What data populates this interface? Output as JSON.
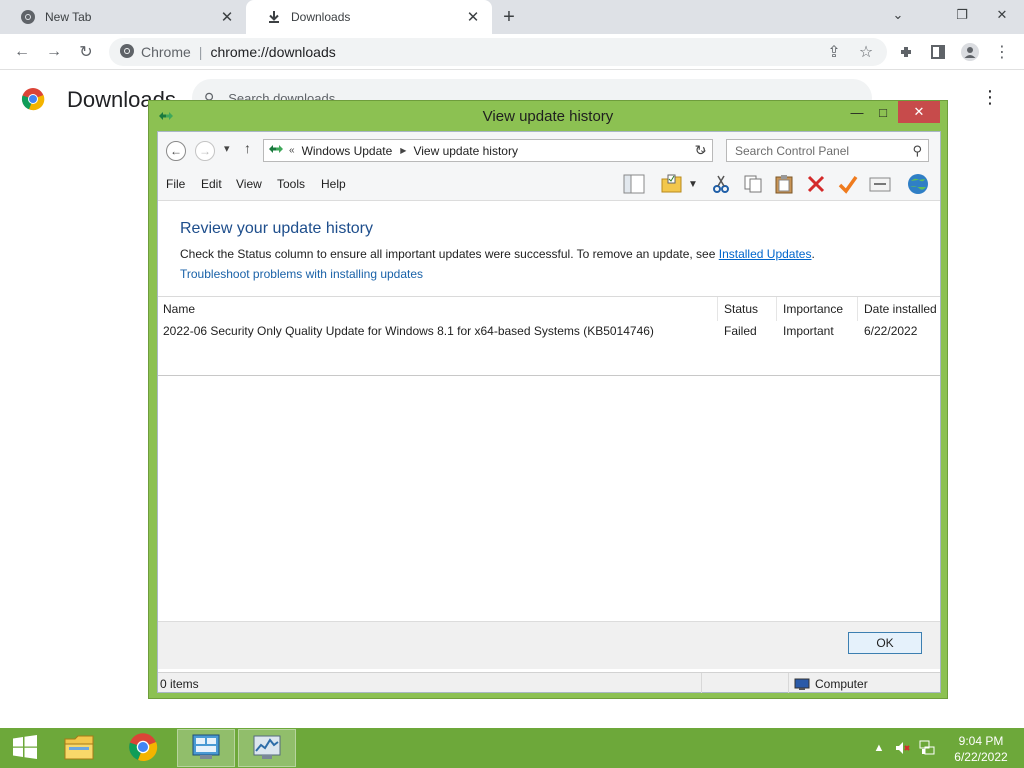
{
  "browser": {
    "tabs": [
      {
        "label": "New Tab",
        "icon": "chrome-icon"
      },
      {
        "label": "Downloads",
        "icon": "download-icon"
      }
    ],
    "omnibox": {
      "site": "Chrome",
      "url": "chrome://downloads"
    },
    "page_title": "Downloads",
    "search_placeholder": "Search downloads"
  },
  "dialog": {
    "title": "View update history",
    "breadcrumb": [
      "Windows Update",
      "View update history"
    ],
    "search_placeholder": "Search Control Panel",
    "menu": [
      "File",
      "Edit",
      "View",
      "Tools",
      "Help"
    ],
    "header": "Review your update history",
    "desc_text": "Check the Status column to ensure all important updates were successful. To remove an update, see ",
    "desc_link": "Installed Updates",
    "desc_end": ".",
    "trouble_link": "Troubleshoot problems with installing updates",
    "columns": [
      "Name",
      "Status",
      "Importance",
      "Date installed"
    ],
    "rows": [
      {
        "name": "2022-06 Security Only Quality Update for Windows 8.1 for x64-based Systems (KB5014746)",
        "status": "Failed",
        "importance": "Important",
        "date": "6/22/2022"
      }
    ],
    "ok_label": "OK",
    "status_left": "0 items",
    "status_right": "Computer"
  },
  "taskbar": {
    "time": "9:04 PM",
    "date": "6/22/2022"
  },
  "colors": {
    "dialog_frame": "#8cc152",
    "taskbar": "#6da83a",
    "link": "#0066cc",
    "header_blue": "#1e4e8c"
  }
}
